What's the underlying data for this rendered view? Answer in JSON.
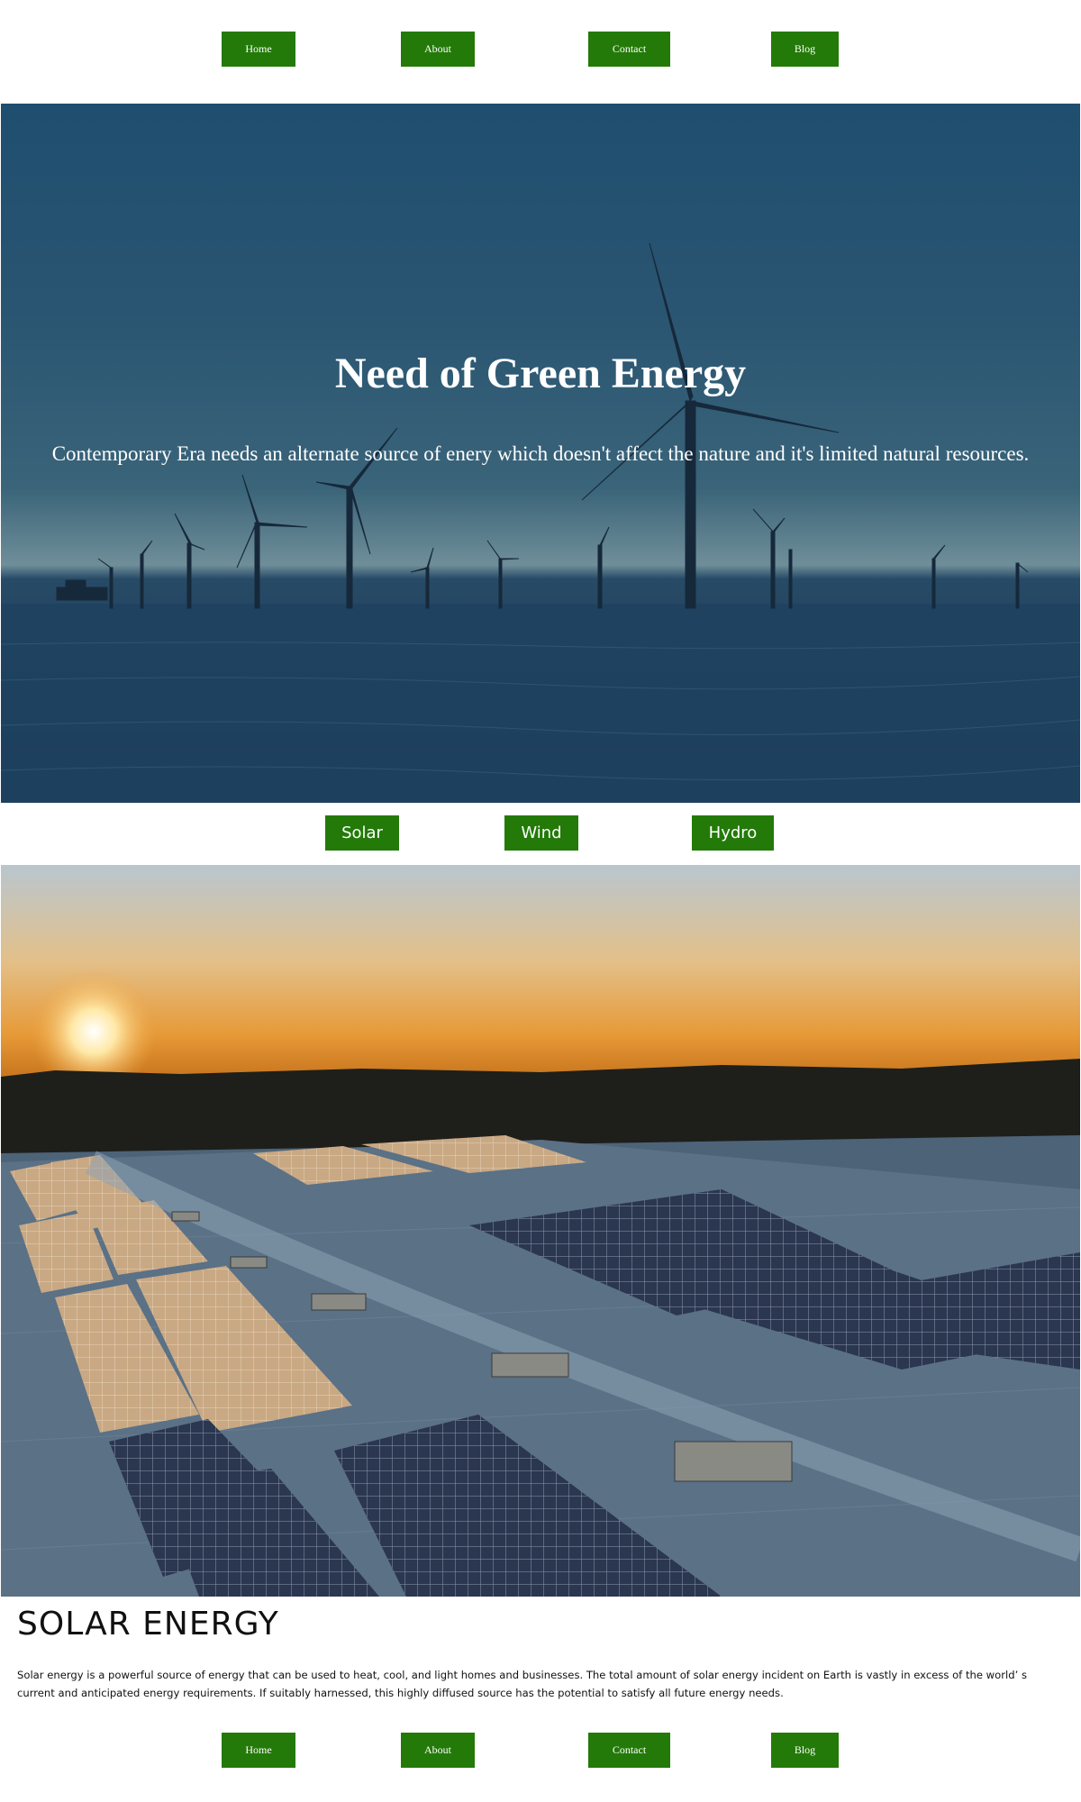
{
  "top_nav": {
    "home": "Home",
    "about": "About",
    "contact": "Contact",
    "blog": "Blog"
  },
  "hero": {
    "title": "Need of Green Energy",
    "subtitle": "Contemporary Era needs an alternate source of enery which doesn't affect the nature and it's limited natural resources."
  },
  "energy_tabs": {
    "solar": "Solar",
    "wind": "Wind",
    "hydro": "Hydro"
  },
  "solar_section": {
    "heading": "SOLAR ENERGY",
    "body": "Solar energy is a powerful source of energy that can be used to heat, cool, and light homes and businesses. The total amount of solar energy incident on Earth is vastly in excess of the world’ s current and anticipated energy requirements. If suitably harnessed, this highly diffused source has the potential to satisfy all future energy needs."
  },
  "bottom_nav": {
    "home": "Home",
    "about": "About",
    "contact": "Contact",
    "blog": "Blog"
  },
  "colors": {
    "button_green": "#237a08",
    "text": "#111111",
    "background": "#ffffff"
  }
}
